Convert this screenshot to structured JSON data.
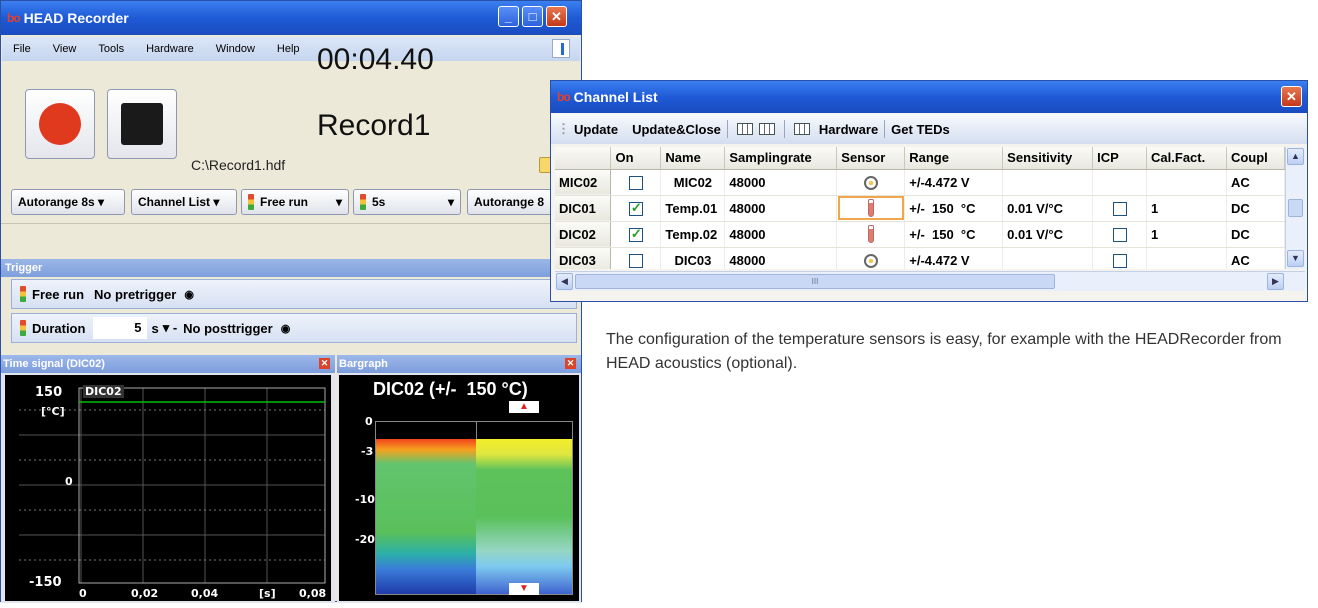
{
  "recorder": {
    "title": "HEAD Recorder",
    "logo": "bo",
    "menu": [
      "File",
      "View",
      "Tools",
      "Hardware",
      "Window",
      "Help"
    ],
    "timer": "00:04.40",
    "record_name": "Record1",
    "file_path": "C:\\Record1.hdf",
    "toolbar": {
      "autorange_left": "Autorange 8s",
      "channel_list": "Channel List",
      "free_run": "Free run",
      "five_s": "5s",
      "autorange_right": "Autorange 8"
    },
    "trigger": {
      "title": "Trigger",
      "row1_mode": "Free run",
      "row1_pre": "No pretrigger",
      "row2_label": "Duration",
      "row2_value": "5",
      "row2_unit": "s",
      "row2_post": "No posttrigger"
    },
    "time_signal": {
      "title": "Time signal (DIC02)",
      "channel": "DIC02",
      "y_top": "150",
      "y_unit": "[°C]",
      "y_mid": "0",
      "y_bottom": "-150",
      "x_ticks": [
        "0",
        "0,02",
        "0,04",
        "[s]",
        "0,08"
      ]
    },
    "bargraph": {
      "title": "Bargraph",
      "header": "DIC02 (+/-  150 °C)",
      "ticks": [
        "0",
        "-3",
        "-10",
        "-20"
      ]
    }
  },
  "channel_list": {
    "title": "Channel List",
    "logo": "bo",
    "toolbar": {
      "update": "Update",
      "update_close": "Update&Close",
      "hardware": "Hardware",
      "get_teds": "Get TEDs"
    },
    "columns": [
      "On",
      "Name",
      "Samplingrate",
      "Sensor",
      "Range",
      "Sensitivity",
      "ICP",
      "Cal.Fact.",
      "Coupl"
    ],
    "rows": [
      {
        "id": "MIC02",
        "on": false,
        "name": "MIC02",
        "rate": "48000",
        "sensor": "microphone-icon",
        "range": "+/-4.472 V",
        "sensitivity": "",
        "icp": null,
        "cal": "",
        "coupling": "AC"
      },
      {
        "id": "DIC01",
        "on": true,
        "name": "Temp.01",
        "rate": "48000",
        "sensor": "thermometer-icon",
        "range": "+/-  150  °C",
        "sensitivity": "0.01 V/°C",
        "icp": false,
        "cal": "1",
        "coupling": "DC"
      },
      {
        "id": "DIC02",
        "on": true,
        "name": "Temp.02",
        "rate": "48000",
        "sensor": "thermometer-icon",
        "range": "+/-  150  °C",
        "sensitivity": "0.01 V/°C",
        "icp": false,
        "cal": "1",
        "coupling": "DC"
      },
      {
        "id": "DIC03",
        "on": false,
        "name": "DIC03",
        "rate": "48000",
        "sensor": "microphone-icon",
        "range": "+/-4.472 V",
        "sensitivity": "",
        "icp": false,
        "cal": "",
        "coupling": "AC"
      }
    ],
    "scrollbar_label": "III"
  },
  "caption": "The configuration of the temperature sensors is easy, for example with the HEADRecorder from HEAD acoustics (optional).",
  "colors": {
    "title_bar": "#1f5ad6",
    "record_red": "#e03a1e",
    "plot_bg": "#000000",
    "trace_green": "#00c000"
  }
}
